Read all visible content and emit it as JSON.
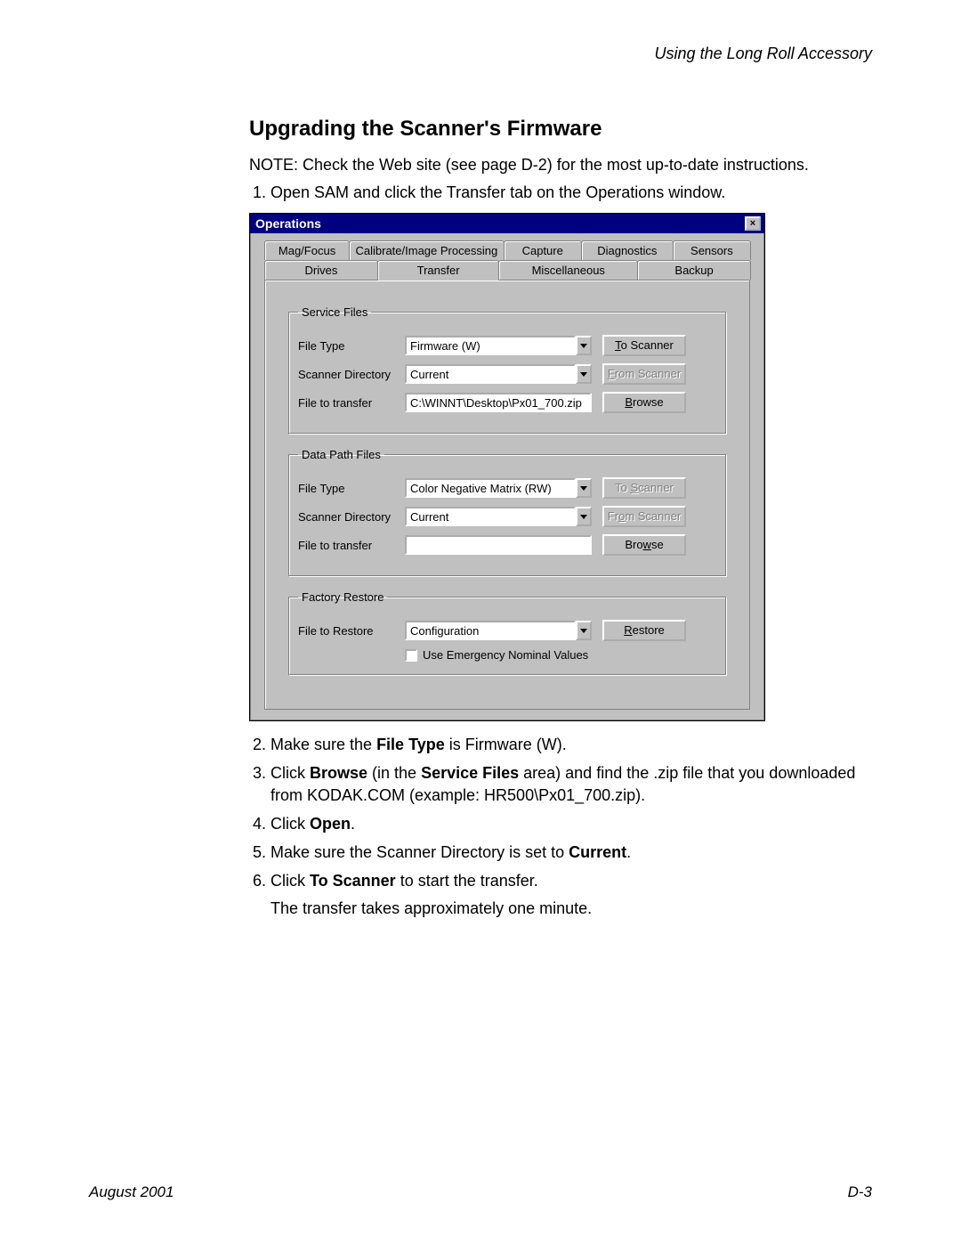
{
  "header": {
    "section": "Using the Long Roll Accessory"
  },
  "title": "Upgrading the Scanner's Firmware",
  "note": "NOTE:  Check the Web site (see page D-2) for the most up-to-date instructions.",
  "step1": "Open SAM and click the Transfer tab on the Operations window.",
  "dialog": {
    "title": "Operations",
    "close": "×",
    "tabs_row1": [
      "Mag/Focus",
      "Calibrate/Image Processing",
      "Capture",
      "Diagnostics",
      "Sensors"
    ],
    "tabs_row2": [
      "Drives",
      "Transfer",
      "Miscellaneous",
      "Backup"
    ],
    "service": {
      "legend": "Service Files",
      "file_type_label": "File Type",
      "file_type_value": "Firmware (W)",
      "scanner_dir_label": "Scanner Directory",
      "scanner_dir_value": "Current",
      "file_transfer_label": "File to transfer",
      "file_transfer_value": "C:\\WINNT\\Desktop\\Px01_700.zip",
      "to_scanner": "To Scanner",
      "from_scanner": "From Scanner",
      "browse": "Browse"
    },
    "datapath": {
      "legend": "Data Path Files",
      "file_type_label": "File Type",
      "file_type_value": "Color Negative Matrix (RW)",
      "scanner_dir_label": "Scanner Directory",
      "scanner_dir_value": "Current",
      "file_transfer_label": "File to transfer",
      "file_transfer_value": "",
      "to_scanner": "To Scanner",
      "from_scanner": "From Scanner",
      "browse": "Browse"
    },
    "factory": {
      "legend": "Factory Restore",
      "file_restore_label": "File to Restore",
      "file_restore_value": "Configuration",
      "restore": "Restore",
      "emergency": "Use Emergency Nominal Values"
    }
  },
  "steps": {
    "s2_pre": "Make sure the ",
    "s2_bold": "File Type",
    "s2_post": " is Firmware (W).",
    "s3_a": "Click ",
    "s3_b": "Browse",
    "s3_c": " (in the ",
    "s3_d": "Service Files",
    "s3_e": " area) and find the .zip file that you downloaded from KODAK.COM (example: HR500\\Px01_700.zip).",
    "s4_a": "Click ",
    "s4_b": "Open",
    "s4_c": ".",
    "s5_a": "Make sure the Scanner Directory is set to ",
    "s5_b": "Current",
    "s5_c": ".",
    "s6_a": "Click ",
    "s6_b": "To Scanner",
    "s6_c": " to start the transfer.",
    "s6_sub": "The transfer takes approximately one minute."
  },
  "footer": {
    "left": "August 2001",
    "right": "D-3"
  }
}
